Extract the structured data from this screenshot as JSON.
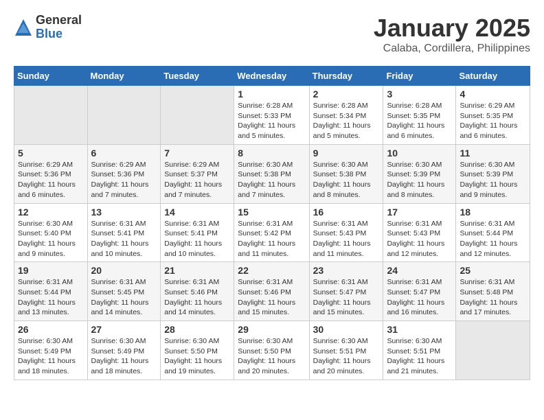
{
  "logo": {
    "general": "General",
    "blue": "Blue"
  },
  "header": {
    "month": "January 2025",
    "location": "Calaba, Cordillera, Philippines"
  },
  "weekdays": [
    "Sunday",
    "Monday",
    "Tuesday",
    "Wednesday",
    "Thursday",
    "Friday",
    "Saturday"
  ],
  "weeks": [
    [
      {
        "day": "",
        "sunrise": "",
        "sunset": "",
        "daylight": ""
      },
      {
        "day": "",
        "sunrise": "",
        "sunset": "",
        "daylight": ""
      },
      {
        "day": "",
        "sunrise": "",
        "sunset": "",
        "daylight": ""
      },
      {
        "day": "1",
        "sunrise": "Sunrise: 6:28 AM",
        "sunset": "Sunset: 5:33 PM",
        "daylight": "Daylight: 11 hours and 5 minutes."
      },
      {
        "day": "2",
        "sunrise": "Sunrise: 6:28 AM",
        "sunset": "Sunset: 5:34 PM",
        "daylight": "Daylight: 11 hours and 5 minutes."
      },
      {
        "day": "3",
        "sunrise": "Sunrise: 6:28 AM",
        "sunset": "Sunset: 5:35 PM",
        "daylight": "Daylight: 11 hours and 6 minutes."
      },
      {
        "day": "4",
        "sunrise": "Sunrise: 6:29 AM",
        "sunset": "Sunset: 5:35 PM",
        "daylight": "Daylight: 11 hours and 6 minutes."
      }
    ],
    [
      {
        "day": "5",
        "sunrise": "Sunrise: 6:29 AM",
        "sunset": "Sunset: 5:36 PM",
        "daylight": "Daylight: 11 hours and 6 minutes."
      },
      {
        "day": "6",
        "sunrise": "Sunrise: 6:29 AM",
        "sunset": "Sunset: 5:36 PM",
        "daylight": "Daylight: 11 hours and 7 minutes."
      },
      {
        "day": "7",
        "sunrise": "Sunrise: 6:29 AM",
        "sunset": "Sunset: 5:37 PM",
        "daylight": "Daylight: 11 hours and 7 minutes."
      },
      {
        "day": "8",
        "sunrise": "Sunrise: 6:30 AM",
        "sunset": "Sunset: 5:38 PM",
        "daylight": "Daylight: 11 hours and 7 minutes."
      },
      {
        "day": "9",
        "sunrise": "Sunrise: 6:30 AM",
        "sunset": "Sunset: 5:38 PM",
        "daylight": "Daylight: 11 hours and 8 minutes."
      },
      {
        "day": "10",
        "sunrise": "Sunrise: 6:30 AM",
        "sunset": "Sunset: 5:39 PM",
        "daylight": "Daylight: 11 hours and 8 minutes."
      },
      {
        "day": "11",
        "sunrise": "Sunrise: 6:30 AM",
        "sunset": "Sunset: 5:39 PM",
        "daylight": "Daylight: 11 hours and 9 minutes."
      }
    ],
    [
      {
        "day": "12",
        "sunrise": "Sunrise: 6:30 AM",
        "sunset": "Sunset: 5:40 PM",
        "daylight": "Daylight: 11 hours and 9 minutes."
      },
      {
        "day": "13",
        "sunrise": "Sunrise: 6:31 AM",
        "sunset": "Sunset: 5:41 PM",
        "daylight": "Daylight: 11 hours and 10 minutes."
      },
      {
        "day": "14",
        "sunrise": "Sunrise: 6:31 AM",
        "sunset": "Sunset: 5:41 PM",
        "daylight": "Daylight: 11 hours and 10 minutes."
      },
      {
        "day": "15",
        "sunrise": "Sunrise: 6:31 AM",
        "sunset": "Sunset: 5:42 PM",
        "daylight": "Daylight: 11 hours and 11 minutes."
      },
      {
        "day": "16",
        "sunrise": "Sunrise: 6:31 AM",
        "sunset": "Sunset: 5:43 PM",
        "daylight": "Daylight: 11 hours and 11 minutes."
      },
      {
        "day": "17",
        "sunrise": "Sunrise: 6:31 AM",
        "sunset": "Sunset: 5:43 PM",
        "daylight": "Daylight: 11 hours and 12 minutes."
      },
      {
        "day": "18",
        "sunrise": "Sunrise: 6:31 AM",
        "sunset": "Sunset: 5:44 PM",
        "daylight": "Daylight: 11 hours and 12 minutes."
      }
    ],
    [
      {
        "day": "19",
        "sunrise": "Sunrise: 6:31 AM",
        "sunset": "Sunset: 5:44 PM",
        "daylight": "Daylight: 11 hours and 13 minutes."
      },
      {
        "day": "20",
        "sunrise": "Sunrise: 6:31 AM",
        "sunset": "Sunset: 5:45 PM",
        "daylight": "Daylight: 11 hours and 14 minutes."
      },
      {
        "day": "21",
        "sunrise": "Sunrise: 6:31 AM",
        "sunset": "Sunset: 5:46 PM",
        "daylight": "Daylight: 11 hours and 14 minutes."
      },
      {
        "day": "22",
        "sunrise": "Sunrise: 6:31 AM",
        "sunset": "Sunset: 5:46 PM",
        "daylight": "Daylight: 11 hours and 15 minutes."
      },
      {
        "day": "23",
        "sunrise": "Sunrise: 6:31 AM",
        "sunset": "Sunset: 5:47 PM",
        "daylight": "Daylight: 11 hours and 15 minutes."
      },
      {
        "day": "24",
        "sunrise": "Sunrise: 6:31 AM",
        "sunset": "Sunset: 5:47 PM",
        "daylight": "Daylight: 11 hours and 16 minutes."
      },
      {
        "day": "25",
        "sunrise": "Sunrise: 6:31 AM",
        "sunset": "Sunset: 5:48 PM",
        "daylight": "Daylight: 11 hours and 17 minutes."
      }
    ],
    [
      {
        "day": "26",
        "sunrise": "Sunrise: 6:30 AM",
        "sunset": "Sunset: 5:49 PM",
        "daylight": "Daylight: 11 hours and 18 minutes."
      },
      {
        "day": "27",
        "sunrise": "Sunrise: 6:30 AM",
        "sunset": "Sunset: 5:49 PM",
        "daylight": "Daylight: 11 hours and 18 minutes."
      },
      {
        "day": "28",
        "sunrise": "Sunrise: 6:30 AM",
        "sunset": "Sunset: 5:50 PM",
        "daylight": "Daylight: 11 hours and 19 minutes."
      },
      {
        "day": "29",
        "sunrise": "Sunrise: 6:30 AM",
        "sunset": "Sunset: 5:50 PM",
        "daylight": "Daylight: 11 hours and 20 minutes."
      },
      {
        "day": "30",
        "sunrise": "Sunrise: 6:30 AM",
        "sunset": "Sunset: 5:51 PM",
        "daylight": "Daylight: 11 hours and 20 minutes."
      },
      {
        "day": "31",
        "sunrise": "Sunrise: 6:30 AM",
        "sunset": "Sunset: 5:51 PM",
        "daylight": "Daylight: 11 hours and 21 minutes."
      },
      {
        "day": "",
        "sunrise": "",
        "sunset": "",
        "daylight": ""
      }
    ]
  ]
}
